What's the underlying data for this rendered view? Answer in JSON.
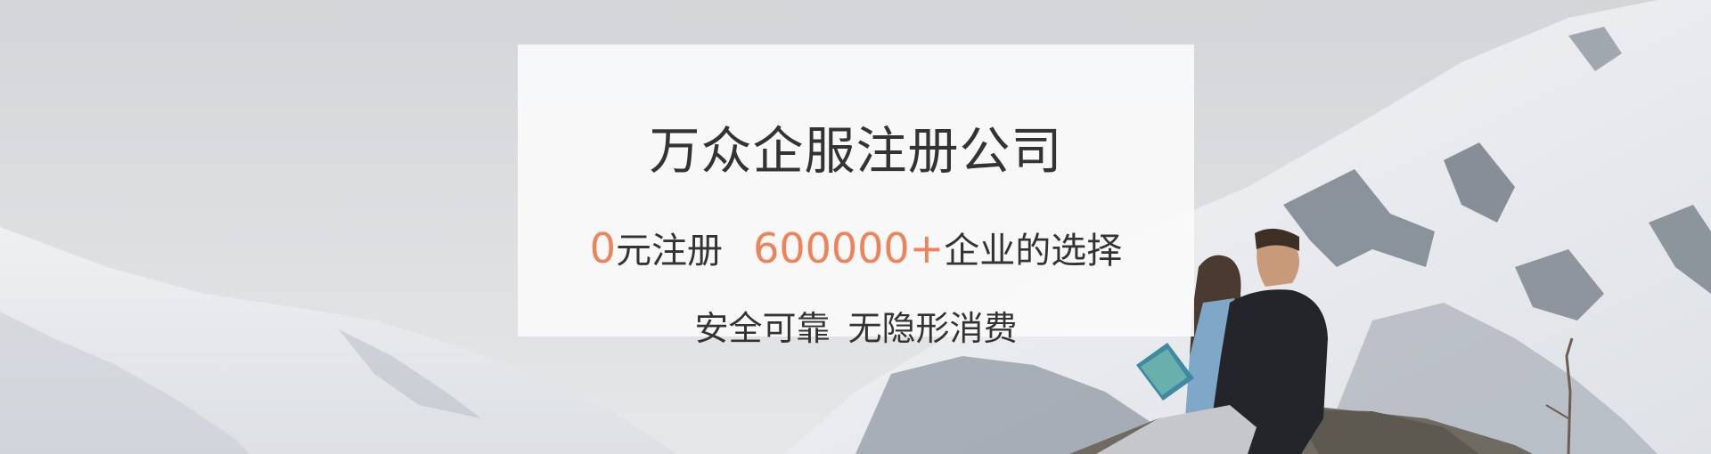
{
  "banner": {
    "title": "万众企服注册公司",
    "promo": {
      "free_number": "0",
      "free_text": "元注册",
      "count_number": "600000+",
      "count_text": "企业的选择"
    },
    "tagline": {
      "part1": "安全可靠",
      "part2": "无隐形消费"
    },
    "colors": {
      "accent": "#f0825a",
      "text": "#333333",
      "card": "#fafafb"
    }
  }
}
